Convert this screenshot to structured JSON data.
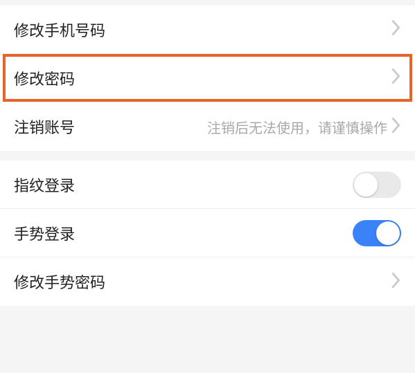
{
  "section1": {
    "items": [
      {
        "label": "修改手机号码",
        "hint": ""
      },
      {
        "label": "修改密码",
        "hint": ""
      },
      {
        "label": "注销账号",
        "hint": "注销后无法使用，请谨慎操作"
      }
    ]
  },
  "section2": {
    "items": [
      {
        "label": "指纹登录",
        "toggle": false
      },
      {
        "label": "手势登录",
        "toggle": true
      },
      {
        "label": "修改手势密码"
      }
    ]
  },
  "highlight_index": 1,
  "colors": {
    "highlight": "#e8632c",
    "toggle_on": "#3a82f7"
  }
}
